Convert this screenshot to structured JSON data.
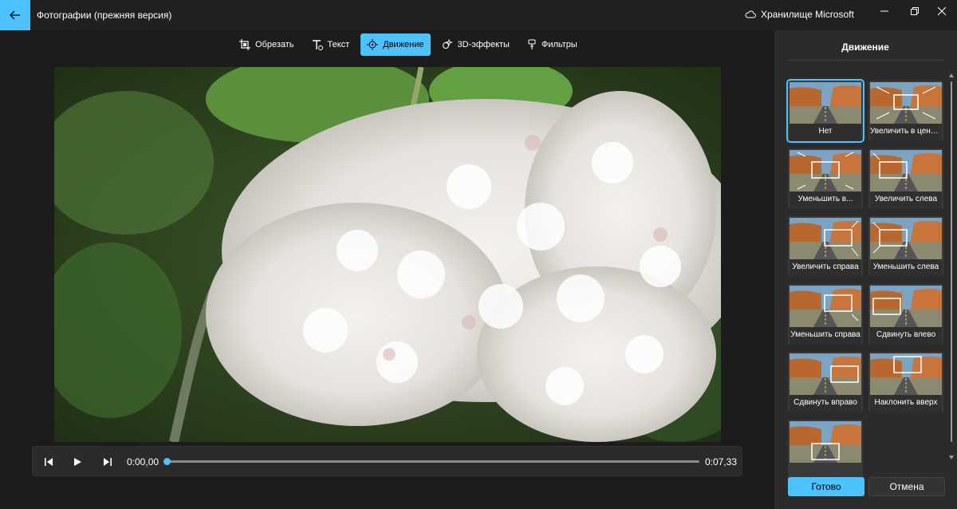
{
  "titlebar": {
    "app_title": "Фотографии (прежняя версия)",
    "storage_label": "Хранилище Microsoft",
    "back_icon": "arrow-left-icon"
  },
  "toolbar": {
    "items": [
      {
        "label": "Обрезать",
        "icon": "crop-icon",
        "active": false
      },
      {
        "label": "Текст",
        "icon": "text-icon",
        "active": false
      },
      {
        "label": "Движение",
        "icon": "motion-icon",
        "active": true
      },
      {
        "label": "3D-эффекты",
        "icon": "3d-effects-icon",
        "active": false
      },
      {
        "label": "Фильтры",
        "icon": "filters-icon",
        "active": false
      }
    ]
  },
  "player": {
    "current_time": "0:00,00",
    "total_time": "0:07,33",
    "progress": 0
  },
  "panel": {
    "title": "Движение",
    "motions": [
      {
        "label": "Нет",
        "selected": true
      },
      {
        "label": "Увеличить в центре",
        "selected": false
      },
      {
        "label": "Уменьшить в...",
        "selected": false
      },
      {
        "label": "Увеличить слева",
        "selected": false
      },
      {
        "label": "Увеличить справа",
        "selected": false
      },
      {
        "label": "Уменьшить слева",
        "selected": false
      },
      {
        "label": "Уменьшить справа",
        "selected": false
      },
      {
        "label": "Сдвинуть влево",
        "selected": false
      },
      {
        "label": "Сдвинуть вправо",
        "selected": false
      },
      {
        "label": "Наклонить вверх",
        "selected": false
      },
      {
        "label": "",
        "selected": false
      }
    ],
    "done_label": "Готово",
    "cancel_label": "Отмена"
  },
  "colors": {
    "accent": "#4cc2ff",
    "background": "#1c1c1c",
    "panel": "#2b2b2b"
  }
}
